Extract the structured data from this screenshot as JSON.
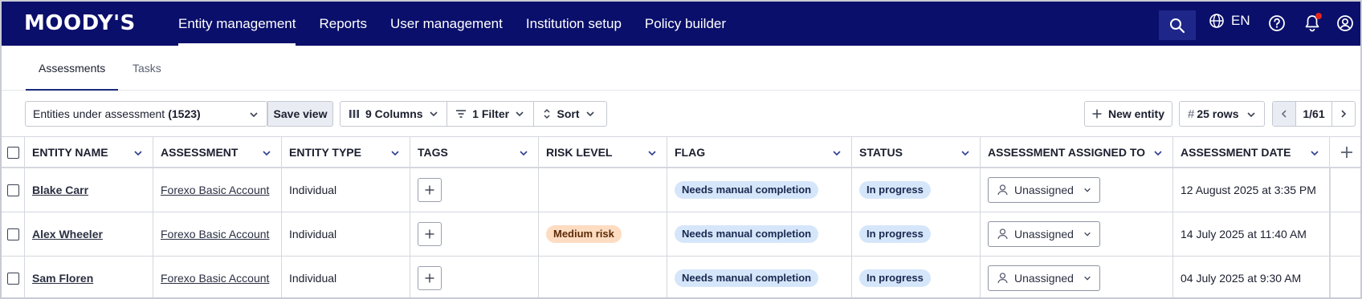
{
  "brand": {
    "logo_text": "MOODY'S"
  },
  "nav": {
    "items": [
      {
        "label": "Entity management",
        "active": true
      },
      {
        "label": "Reports",
        "active": false
      },
      {
        "label": "User management",
        "active": false
      },
      {
        "label": "Institution setup",
        "active": false
      },
      {
        "label": "Policy builder",
        "active": false
      }
    ],
    "language": "EN",
    "notification_badge_color": "#e2251b"
  },
  "subtabs": {
    "items": [
      {
        "label": "Assessments",
        "active": true
      },
      {
        "label": "Tasks",
        "active": false
      }
    ]
  },
  "toolbar": {
    "view_label": "Entities under assessment",
    "view_count": "(1523)",
    "save_view": "Save view",
    "columns": "9 Columns",
    "filter": "1 Filter",
    "sort": "Sort",
    "new_entity": "New entity",
    "rows_hash": "#",
    "rows": "25 rows",
    "page": "1/61"
  },
  "table": {
    "headers": [
      "ENTITY NAME",
      "ASSESSMENT",
      "ENTITY TYPE",
      "TAGS",
      "RISK LEVEL",
      "FLAG",
      "STATUS",
      "ASSESSMENT ASSIGNED TO",
      "ASSESSMENT DATE"
    ],
    "rows": [
      {
        "entity": "Blake Carr",
        "assessment": "Forexo Basic Account",
        "type": "Individual",
        "risk": "",
        "flag": "Needs manual completion",
        "status": "In progress",
        "assigned": "Unassigned",
        "date": "12 August 2025 at 3:35 PM"
      },
      {
        "entity": "Alex Wheeler",
        "assessment": "Forexo Basic Account",
        "type": "Individual",
        "risk": "Medium risk",
        "flag": "Needs manual completion",
        "status": "In progress",
        "assigned": "Unassigned",
        "date": "14 July 2025 at 11:40 AM"
      },
      {
        "entity": "Sam Floren",
        "assessment": "Forexo Basic Account",
        "type": "Individual",
        "risk": "",
        "flag": "Needs manual completion",
        "status": "In progress",
        "assigned": "Unassigned",
        "date": "04 July 2025 at 9:30 AM"
      }
    ]
  },
  "colors": {
    "topbar": "#0a0f6b",
    "pill_blue": "#d6e6fa",
    "pill_orange": "#fddcc2"
  }
}
